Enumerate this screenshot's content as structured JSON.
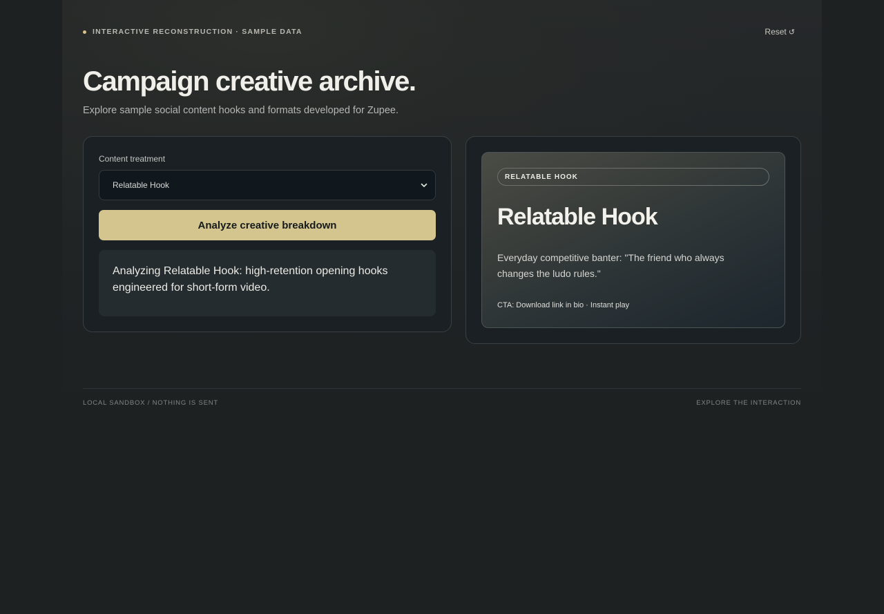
{
  "header": {
    "eyebrow": "INTERACTIVE RECONSTRUCTION · SAMPLE DATA",
    "reset_label": "Reset",
    "reset_icon": "↺"
  },
  "hero": {
    "title": "Campaign creative archive.",
    "subtitle": "Explore sample social content hooks and formats developed for Zupee."
  },
  "controls": {
    "field_label": "Content treatment",
    "selected_treatment": "Relatable Hook",
    "analyze_label": "Analyze creative breakdown",
    "result_text": "Analyzing Relatable Hook: high-retention opening hooks engineered for short-form video."
  },
  "preview": {
    "tag": "RELATABLE HOOK",
    "title": "Relatable Hook",
    "description": "Everyday competitive banter: \"The friend who always changes the ludo rules.\"",
    "cta": "CTA: Download link in bio · Instant play"
  },
  "footer": {
    "left": "LOCAL SANDBOX / NOTHING IS SENT",
    "right": "EXPLORE THE INTERACTION"
  },
  "colors": {
    "accent": "#d3c58d",
    "background": "#1d2122",
    "panel": "#1a2023"
  }
}
